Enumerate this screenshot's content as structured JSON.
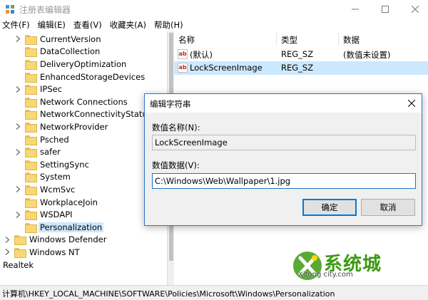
{
  "window": {
    "title": "注册表编辑器",
    "icon": "regedit-icon"
  },
  "menu": [
    "文件(F)",
    "编辑(E)",
    "查看(V)",
    "收藏夹(A)",
    "帮助(H)"
  ],
  "tree": {
    "items": [
      {
        "label": "CurrentVersion",
        "expandable": true
      },
      {
        "label": "DataCollection",
        "expandable": false
      },
      {
        "label": "DeliveryOptimization",
        "expandable": false
      },
      {
        "label": "EnhancedStorageDevices",
        "expandable": false
      },
      {
        "label": "IPSec",
        "expandable": true
      },
      {
        "label": "Network Connections",
        "expandable": false
      },
      {
        "label": "NetworkConnectivityStatusIn",
        "expandable": false
      },
      {
        "label": "NetworkProvider",
        "expandable": true
      },
      {
        "label": "Psched",
        "expandable": false
      },
      {
        "label": "safer",
        "expandable": true
      },
      {
        "label": "SettingSync",
        "expandable": false
      },
      {
        "label": "System",
        "expandable": false
      },
      {
        "label": "WcmSvc",
        "expandable": true
      },
      {
        "label": "WorkplaceJoin",
        "expandable": false
      },
      {
        "label": "WSDAPI",
        "expandable": true
      },
      {
        "label": "Personalization",
        "expandable": false,
        "selected": true
      },
      {
        "label": "Windows Defender",
        "expandable": true
      },
      {
        "label": "Windows NT",
        "expandable": true
      }
    ],
    "root_item": "Realtek"
  },
  "list": {
    "columns": [
      "名称",
      "类型",
      "数据"
    ],
    "rows": [
      {
        "name": "(默认)",
        "type": "REG_SZ",
        "data": "(数值未设置)",
        "icon": "ab",
        "selected": false
      },
      {
        "name": "LockScreenImage",
        "type": "REG_SZ",
        "data": "",
        "icon": "ab",
        "selected": true
      }
    ]
  },
  "status": {
    "path": "计算机\\HKEY_LOCAL_MACHINE\\SOFTWARE\\Policies\\Microsoft\\Windows\\Personalization"
  },
  "dialog": {
    "title": "编辑字符串",
    "name_label": "数值名称(N):",
    "name_value": "LockScreenImage",
    "data_label": "数值数据(V):",
    "data_value": "C:\\Windows\\Web\\Wallpaper\\1.jpg",
    "ok_label": "确定",
    "cancel_label": "取消"
  },
  "watermark": {
    "text": "系统城",
    "sub": "Xitong city.com",
    "color": "#3d9a12"
  }
}
